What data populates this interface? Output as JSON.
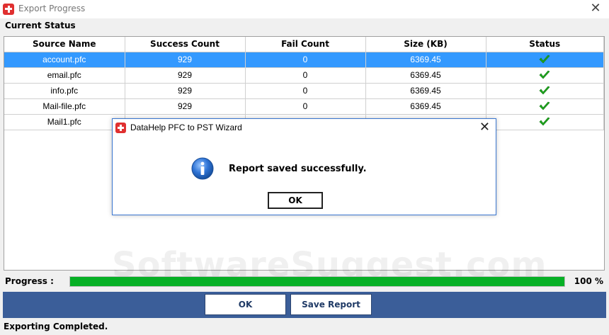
{
  "window": {
    "title": "Export Progress",
    "close_glyph": "✕",
    "icon": "app-logo-icon"
  },
  "section_title": "Current Status",
  "table": {
    "columns": [
      "Source Name",
      "Success Count",
      "Fail Count",
      "Size (KB)",
      "Status"
    ],
    "rows": [
      {
        "source": "account.pfc",
        "success": "929",
        "fail": "0",
        "size": "6369.45",
        "status": "check-icon",
        "selected": true
      },
      {
        "source": "email.pfc",
        "success": "929",
        "fail": "0",
        "size": "6369.45",
        "status": "check-icon",
        "selected": false
      },
      {
        "source": "info.pfc",
        "success": "929",
        "fail": "0",
        "size": "6369.45",
        "status": "check-icon",
        "selected": false
      },
      {
        "source": "Mail-file.pfc",
        "success": "929",
        "fail": "0",
        "size": "6369.45",
        "status": "check-icon",
        "selected": false
      },
      {
        "source": "Mail1.pfc",
        "success": "",
        "fail": "",
        "size": "",
        "status": "check-icon",
        "selected": false
      }
    ]
  },
  "progress": {
    "label": "Progress :",
    "percent_text": "100 %",
    "value": 1.0,
    "color": "#06b025"
  },
  "buttons": {
    "ok_label": "OK",
    "save_report_label": "Save Report"
  },
  "status_text": "Exporting Completed.",
  "watermark": "SoftwareSuggest.com",
  "dialog": {
    "title": "DataHelp PFC to PST Wizard",
    "close_glyph": "✕",
    "message": "Report saved successfully.",
    "ok_label": "OK",
    "icon": "info-icon"
  },
  "colors": {
    "selection": "#3399ff",
    "footer_band": "#3b5e99",
    "check": "#1fa81f"
  }
}
